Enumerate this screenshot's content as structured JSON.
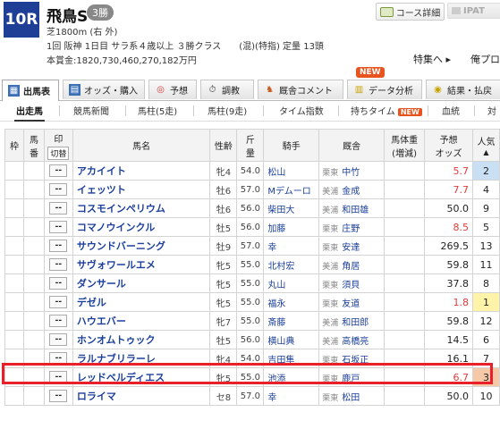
{
  "race": {
    "number": "10R",
    "name": "飛鳥S",
    "class_badge": "3勝",
    "course": "芝1800m (右 外)",
    "details": "1回 阪神 1日目 サラ系４歳以上 ３勝クラス　　(混)(特指) 定量 13頭",
    "prize": "本賞金:1820,730,460,270,182万円"
  },
  "header": {
    "course_detail_label": "コース詳細",
    "ipat_label": "IPAT",
    "special_link": "特集へ ▸",
    "ore_label": "俺プロ"
  },
  "main_tabs": [
    {
      "label": "出馬表",
      "icon": "table-icon"
    },
    {
      "label": "オッズ・購入",
      "icon": "odds-icon"
    },
    {
      "label": "予想",
      "icon": "target-icon"
    },
    {
      "label": "調教",
      "icon": "stopwatch-icon"
    },
    {
      "label": "厩舎コメント",
      "icon": "horse-icon"
    },
    {
      "label": "データ分析",
      "icon": "bar-chart-icon"
    },
    {
      "label": "結果・払戻",
      "icon": "coins-icon"
    }
  ],
  "new_badge": "NEW",
  "sub_tabs": [
    "出走馬",
    "競馬新聞",
    "馬柱(5走)",
    "馬柱(9走)",
    "タイム指数",
    "持ちタイム",
    "血統",
    "対"
  ],
  "sub_new_tag": "NEW",
  "columns": {
    "waku": "枠",
    "umaban_1": "馬",
    "umaban_2": "番",
    "mark": "印",
    "mark_toggle": "切替",
    "name": "馬名",
    "sex_age": "性齢",
    "kinryo_1": "斤",
    "kinryo_2": "量",
    "jockey": "騎手",
    "trainer": "厩舎",
    "weight_1": "馬体重",
    "weight_2": "(増減)",
    "odds_1": "予想",
    "odds_2": "オッズ",
    "pop_1": "人気",
    "pop_2": "▲"
  },
  "horses": [
    {
      "mark": "--",
      "name": "アカイイト",
      "sex_age": "牝4",
      "kinryo": "54.0",
      "jockey": "松山",
      "area": "栗東",
      "trainer": "中竹",
      "odds": "5.7",
      "odds_red": true,
      "pop": "2"
    },
    {
      "mark": "--",
      "name": "イェッツト",
      "sex_age": "牡6",
      "kinryo": "57.0",
      "jockey": "Mデムーロ",
      "area": "美浦",
      "trainer": "金成",
      "odds": "7.7",
      "odds_red": true,
      "pop": "4"
    },
    {
      "mark": "--",
      "name": "コスモインペリウム",
      "sex_age": "牡6",
      "kinryo": "56.0",
      "jockey": "柴田大",
      "area": "美浦",
      "trainer": "和田雄",
      "odds": "50.0",
      "odds_red": false,
      "pop": "9"
    },
    {
      "mark": "--",
      "name": "コマノウインクル",
      "sex_age": "牡5",
      "kinryo": "56.0",
      "jockey": "加藤",
      "area": "栗東",
      "trainer": "庄野",
      "odds": "8.5",
      "odds_red": true,
      "pop": "5"
    },
    {
      "mark": "--",
      "name": "サウンドバーニング",
      "sex_age": "牡9",
      "kinryo": "57.0",
      "jockey": "幸",
      "area": "栗東",
      "trainer": "安達",
      "odds": "269.5",
      "odds_red": false,
      "pop": "13"
    },
    {
      "mark": "--",
      "name": "サヴォワールエメ",
      "sex_age": "牝5",
      "kinryo": "55.0",
      "jockey": "北村宏",
      "area": "美浦",
      "trainer": "角居",
      "odds": "59.8",
      "odds_red": false,
      "pop": "11"
    },
    {
      "mark": "--",
      "name": "ダンサール",
      "sex_age": "牝5",
      "kinryo": "55.0",
      "jockey": "丸山",
      "area": "栗東",
      "trainer": "須貝",
      "odds": "37.8",
      "odds_red": false,
      "pop": "8"
    },
    {
      "mark": "--",
      "name": "デゼル",
      "sex_age": "牝5",
      "kinryo": "55.0",
      "jockey": "福永",
      "area": "栗東",
      "trainer": "友道",
      "odds": "1.8",
      "odds_red": true,
      "pop": "1"
    },
    {
      "mark": "--",
      "name": "ハウエバー",
      "sex_age": "牝7",
      "kinryo": "55.0",
      "jockey": "斎藤",
      "area": "美浦",
      "trainer": "和田郎",
      "odds": "59.8",
      "odds_red": false,
      "pop": "12"
    },
    {
      "mark": "--",
      "name": "ホンオムトゥック",
      "sex_age": "牡5",
      "kinryo": "56.0",
      "jockey": "横山典",
      "area": "美浦",
      "trainer": "高橋亮",
      "odds": "14.5",
      "odds_red": false,
      "pop": "6"
    },
    {
      "mark": "--",
      "name": "ラルナブリラーレ",
      "sex_age": "牝4",
      "kinryo": "54.0",
      "jockey": "吉田隼",
      "area": "栗東",
      "trainer": "石坂正",
      "odds": "16.1",
      "odds_red": false,
      "pop": "7"
    },
    {
      "mark": "--",
      "name": "レッドベルディエス",
      "sex_age": "牝5",
      "kinryo": "55.0",
      "jockey": "池添",
      "area": "栗東",
      "trainer": "鹿戸",
      "odds": "6.7",
      "odds_red": true,
      "pop": "3"
    },
    {
      "mark": "--",
      "name": "ロライマ",
      "sex_age": "セ8",
      "kinryo": "57.0",
      "jockey": "幸",
      "area": "栗東",
      "trainer": "松田",
      "odds": "50.0",
      "odds_red": false,
      "pop": "10"
    }
  ],
  "colors": {
    "brand": "#1f3f96",
    "link": "#1b3f9b",
    "odds_red": "#e03a3a",
    "highlight": "#e8202a",
    "new": "#e8541e"
  }
}
